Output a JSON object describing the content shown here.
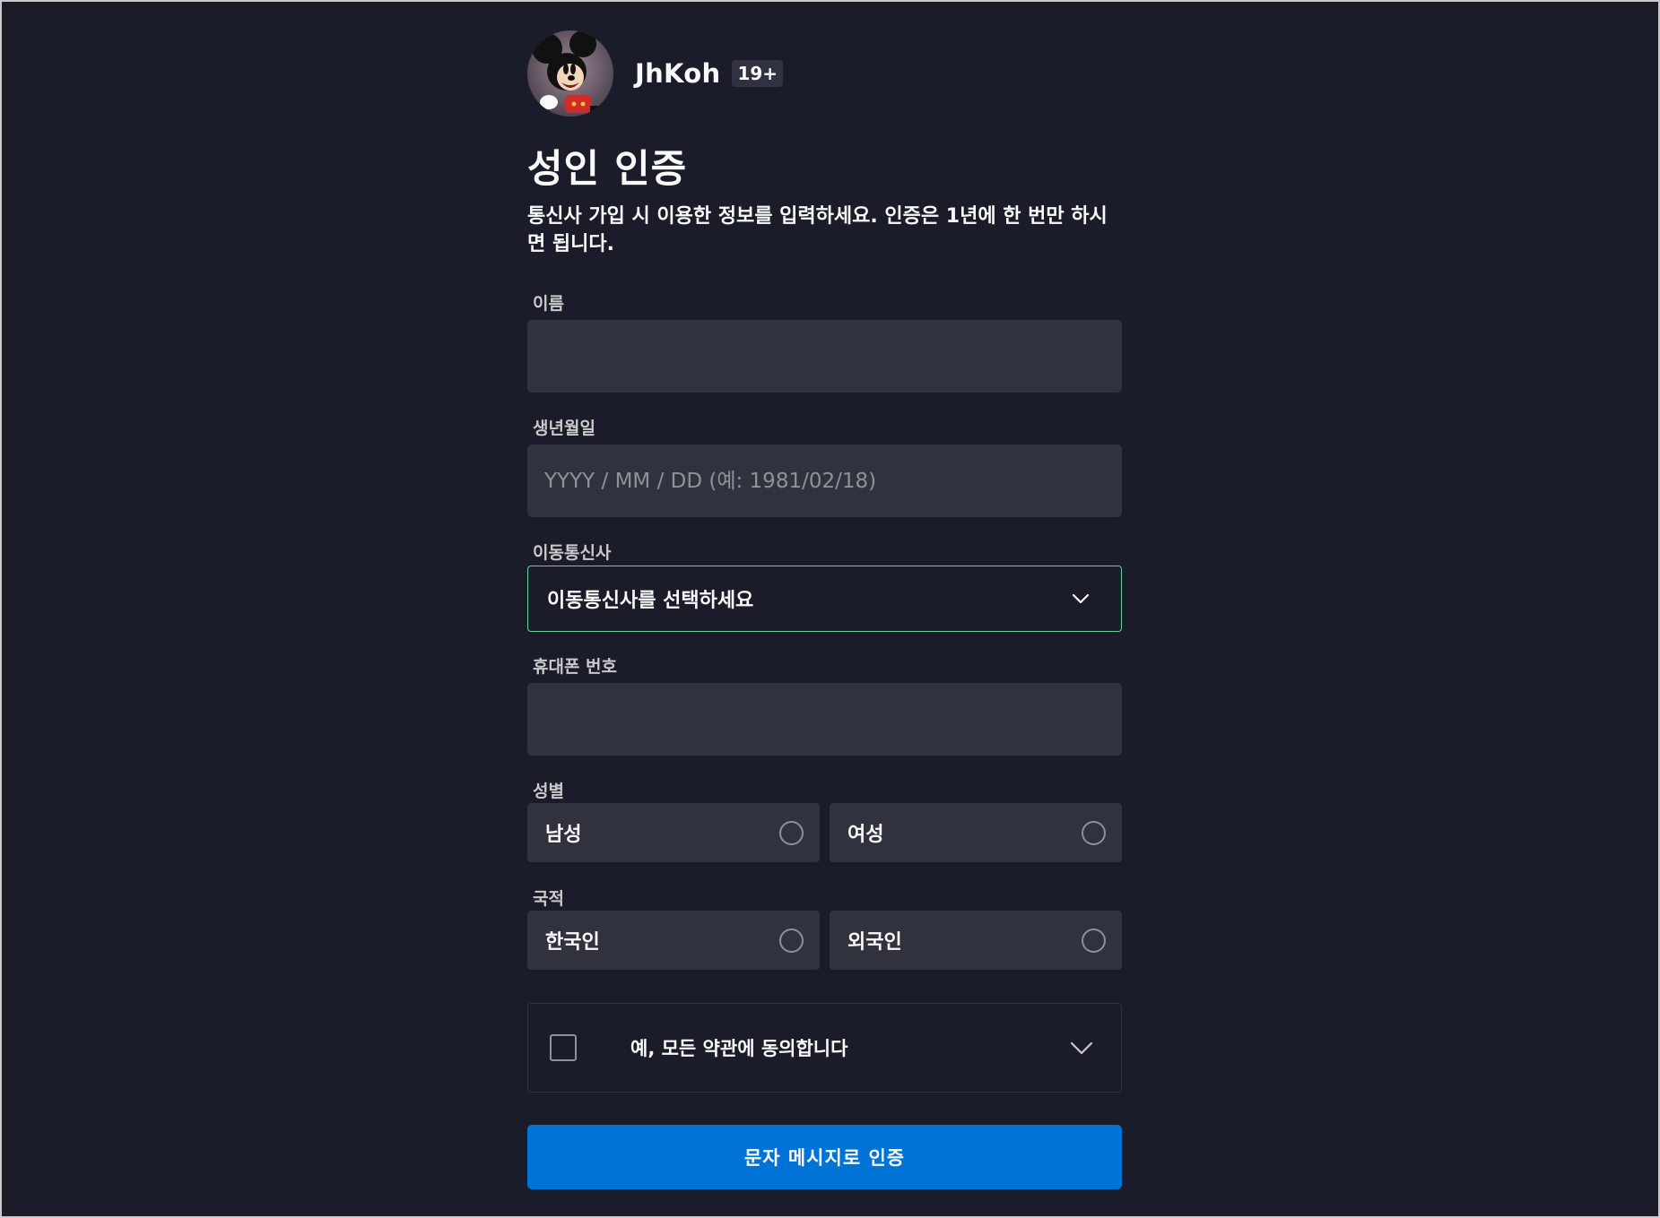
{
  "profile": {
    "name": "JhKoh",
    "rating": "19+",
    "avatar_icon": "mickey-mouse-avatar"
  },
  "page": {
    "title": "성인 인증",
    "description": "통신사 가입 시 이용한 정보를 입력하세요. 인증은 1년에 한 번만 하시면 됩니다."
  },
  "form": {
    "name": {
      "label": "이름",
      "value": "",
      "placeholder": ""
    },
    "birthdate": {
      "label": "생년월일",
      "value": "",
      "placeholder": "YYYY / MM / DD (예: 1981/02/18)"
    },
    "carrier": {
      "label": "이동통신사",
      "selected": "이동통신사를 선택하세요"
    },
    "phone": {
      "label": "휴대폰 번호",
      "value": "",
      "placeholder": ""
    },
    "gender": {
      "label": "성별",
      "options": [
        {
          "label": "남성",
          "selected": false
        },
        {
          "label": "여성",
          "selected": false
        }
      ]
    },
    "nationality": {
      "label": "국적",
      "options": [
        {
          "label": "한국인",
          "selected": false
        },
        {
          "label": "외국인",
          "selected": false
        }
      ]
    },
    "terms": {
      "label": "예, 모든 약관에 동의합니다",
      "checked": false
    },
    "submit_label": "문자 메시지로 인증"
  },
  "colors": {
    "background": "#1a1d29",
    "input_background": "#30323e",
    "focus_border": "#5fd2a0",
    "primary_button": "#0074d6",
    "text": "#f9f9f9"
  }
}
